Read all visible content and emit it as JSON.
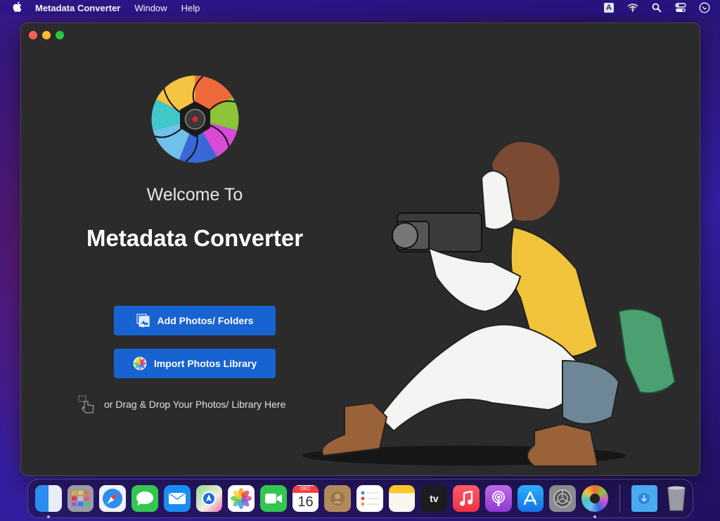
{
  "menubar": {
    "app_name": "Metadata Converter",
    "menus": [
      "Window",
      "Help"
    ],
    "status_icons": [
      "keyboard-input-A-icon",
      "wifi-icon",
      "search-icon",
      "control-center-icon",
      "siri-icon"
    ],
    "keyboard_label": "A"
  },
  "window": {
    "welcome": "Welcome To",
    "title": "Metadata Converter",
    "add_button": "Add Photos/ Folders",
    "import_button": "Import Photos Library",
    "drag_hint": "or Drag & Drop Your Photos/ Library Here"
  },
  "dock": {
    "apps": [
      "Finder",
      "Launchpad",
      "Safari",
      "Messages",
      "Mail",
      "Maps",
      "Photos",
      "FaceTime",
      "Calendar",
      "Contacts",
      "Reminders",
      "Notes",
      "Apple TV",
      "Music",
      "Podcasts",
      "App Store",
      "System Preferences",
      "Metadata Converter"
    ],
    "calendar_month": "DEC",
    "calendar_day": "16",
    "tv_label": "tv",
    "others": [
      "Downloads",
      "Trash"
    ]
  }
}
